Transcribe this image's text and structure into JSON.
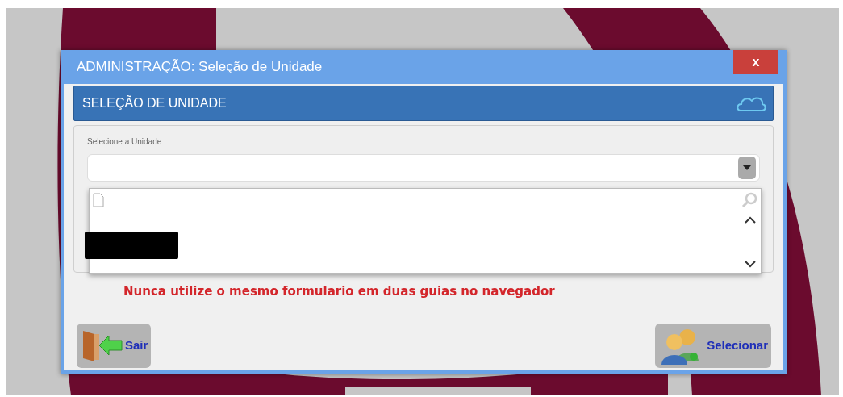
{
  "window": {
    "title": "ADMINISTRAÇÃO: Seleção de Unidade",
    "close_label": "x"
  },
  "panel": {
    "title": "SELEÇÃO DE UNIDADE"
  },
  "field": {
    "label": "Selecione a Unidade",
    "expanded": true
  },
  "dropdown": {
    "options": [
      {
        "kind": "redacted",
        "selected": false
      }
    ]
  },
  "warning": "Nunca utilize o mesmo formulario em duas guias no navegador",
  "buttons": [
    {
      "kind": "exit",
      "label": "Sair"
    },
    {
      "kind": "select",
      "label": "Selecionar"
    }
  ]
}
